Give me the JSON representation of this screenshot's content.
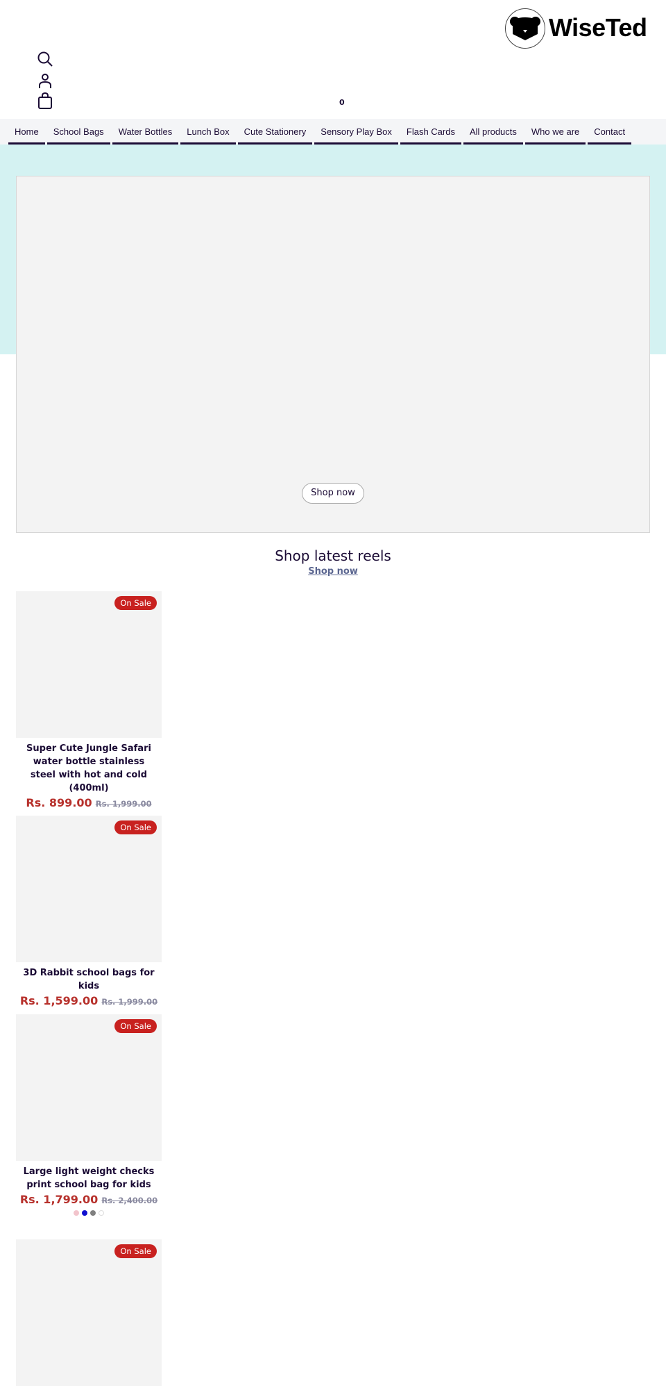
{
  "header": {
    "logo_text": "WiseTed",
    "cart_count": "0",
    "icons": [
      "search-icon",
      "user-icon",
      "bag-icon"
    ]
  },
  "nav": {
    "items": [
      "Home",
      "School Bags",
      "Water Bottles",
      "Lunch Box",
      "Cute Stationery",
      "Sensory Play Box",
      "Flash Cards",
      "All products",
      "Who we are",
      "Contact"
    ]
  },
  "hero": {
    "button": "Shop now",
    "band_color": "#d4f2f2"
  },
  "section": {
    "title": "Shop latest reels",
    "link": "Shop now"
  },
  "products": [
    {
      "badge": "On Sale",
      "title": "Super Cute Jungle Safari water bottle stainless steel with hot and cold (400ml)",
      "price": "Rs. 899.00",
      "compare_price": "Rs. 1,999.00"
    },
    {
      "badge": "On Sale",
      "title": "3D Rabbit school bags for kids",
      "price": "Rs. 1,599.00",
      "compare_price": "Rs. 1,999.00"
    },
    {
      "badge": "On Sale",
      "title": "Large light weight checks print school bag for kids",
      "price": "Rs. 1,799.00",
      "compare_price": "Rs. 2,400.00",
      "swatches": [
        "#f2c4cc",
        "#1010d0",
        "#808080",
        "#ffffff"
      ]
    },
    {
      "badge": "On Sale"
    }
  ],
  "colors": {
    "sale": "#b7312c",
    "badge": "#c8211f",
    "text": "#1b0b35"
  }
}
